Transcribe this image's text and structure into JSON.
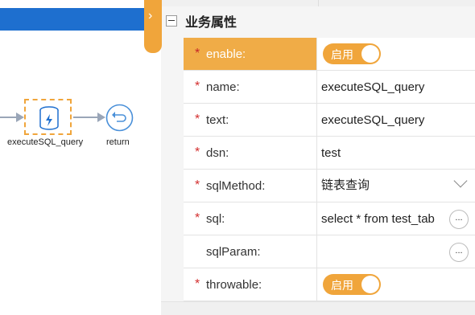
{
  "canvas": {
    "node_exec_label": "executeSQL_query",
    "node_return_label": "return"
  },
  "panel": {
    "section_title": "业务属性",
    "rows": [
      {
        "key": "enable:",
        "required": true,
        "type": "toggle",
        "value": "启用",
        "active": true
      },
      {
        "key": "name:",
        "required": true,
        "type": "text",
        "value": "executeSQL_query"
      },
      {
        "key": "text:",
        "required": true,
        "type": "text",
        "value": "executeSQL_query"
      },
      {
        "key": "dsn:",
        "required": true,
        "type": "text",
        "value": "test"
      },
      {
        "key": "sqlMethod:",
        "required": true,
        "type": "select",
        "value": "链表查询"
      },
      {
        "key": "sql:",
        "required": true,
        "type": "text-more",
        "value": "select * from test_tab"
      },
      {
        "key": "sqlParam:",
        "required": false,
        "type": "text-more",
        "value": ""
      },
      {
        "key": "throwable:",
        "required": true,
        "type": "toggle",
        "value": "启用"
      }
    ],
    "required_mark": "*",
    "more_label": "..."
  },
  "colors": {
    "accent": "#f0a53b",
    "header_bar": "#1e6fcf",
    "required": "#d32f2f"
  }
}
